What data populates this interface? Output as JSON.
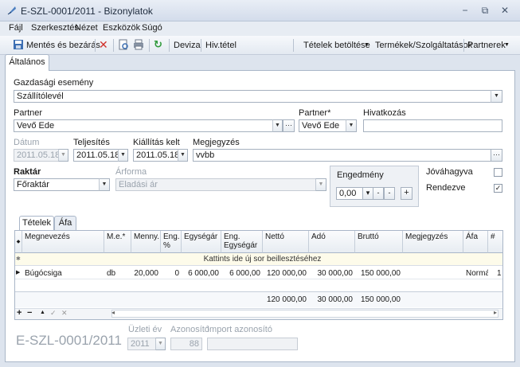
{
  "window": {
    "title": "E-SZL-0001/2011 - Bizonylatok",
    "min": "−",
    "restore": "⧉",
    "close": "✕"
  },
  "menu": [
    "Fájl",
    "Szerkesztés",
    "Nézet",
    "Eszközök",
    "Súgó"
  ],
  "toolbar": {
    "save_close": "Mentés és bezárás",
    "deviza": "Deviza",
    "hivtetel": "Hiv.tétel",
    "tetelek_betoltese": "Tételek betöltése",
    "termekek": "Termékek/Szolgáltatások",
    "partnerek": "Partnerek"
  },
  "tab": "Általános",
  "gazdasagi": {
    "label": "Gazdasági esemény",
    "value": "Szállítólevél"
  },
  "partner1": {
    "label": "Partner",
    "value": "Vevő Ede"
  },
  "partner2": {
    "label": "Partner*",
    "value": "Vevő Ede"
  },
  "hivatkozas": {
    "label": "Hivatkozás",
    "value": ""
  },
  "datum": {
    "label": "Dátum",
    "value": "2011.05.18."
  },
  "teljesites": {
    "label": "Teljesítés",
    "value": "2011.05.18."
  },
  "kiallitas": {
    "label": "Kiállítás kelt",
    "value": "2011.05.18."
  },
  "megjegyzes": {
    "label": "Megjegyzés",
    "value": "vvbb"
  },
  "raktar": {
    "label": "Raktár",
    "value": "Főraktár"
  },
  "arforma": {
    "label": "Árforma",
    "value": "Eladási ár"
  },
  "engedmeny": {
    "label": "Engedmény",
    "value": "0,00"
  },
  "jovahagyva": {
    "label": "Jóváhagyva",
    "checked": false
  },
  "rendezve": {
    "label": "Rendezve",
    "checked": true
  },
  "grid": {
    "tabs": [
      "Tételek",
      "Áfa"
    ],
    "columns": [
      "Megnevezés",
      "M.e.*",
      "Menny.",
      "Eng. %",
      "Egységár",
      "Eng. Egységár",
      "Nettó",
      "Adó",
      "Bruttó",
      "Megjegyzés",
      "Áfa",
      "#"
    ],
    "new_row": "Kattints ide új sor beillesztéséhez",
    "rows": [
      [
        "Búgócsiga",
        "db",
        "20,000",
        "0",
        "6 000,00",
        "6 000,00",
        "120 000,00",
        "30 000,00",
        "150 000,00",
        "",
        "Normál",
        "1"
      ]
    ],
    "totals": {
      "netto": "120 000,00",
      "ado": "30 000,00",
      "brutto": "150 000,00"
    }
  },
  "footer": {
    "doc_id": "E-SZL-0001/2011",
    "uzleti_ev_label": "Üzleti év",
    "uzleti_ev": "2011",
    "azonosito_label": "Azonosító",
    "azonosito": "88",
    "import_label": "Import azonosító",
    "import": ""
  }
}
